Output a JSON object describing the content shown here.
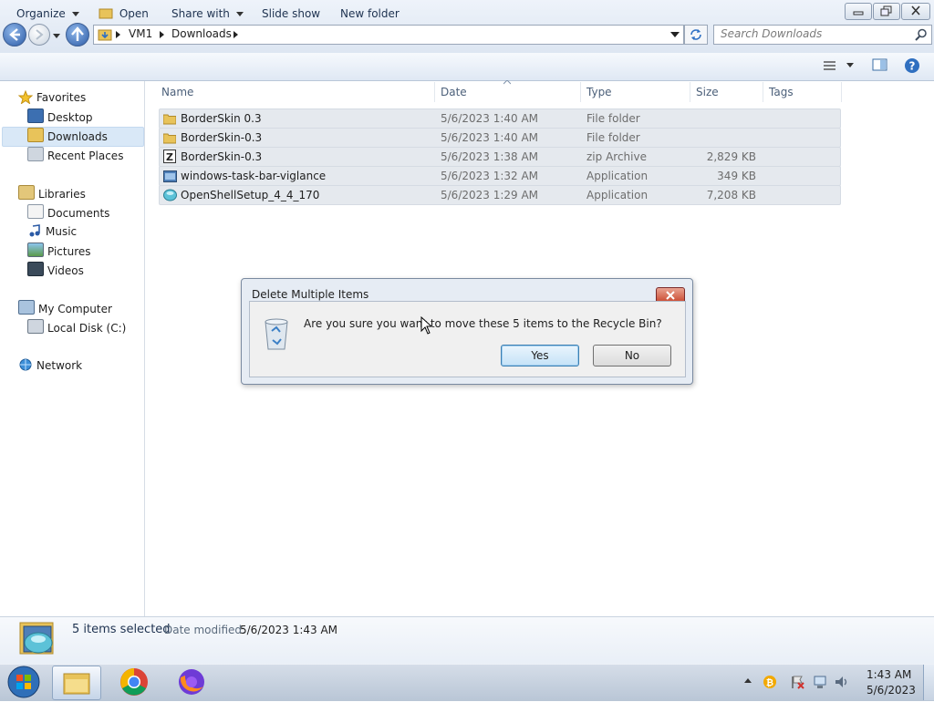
{
  "window": {
    "minimize_label": "▭",
    "restore_label": "❐",
    "close_label": "✕"
  },
  "address": {
    "segments": [
      "VM1",
      "Downloads"
    ],
    "search_placeholder": "Search Downloads"
  },
  "toolbar": {
    "organize": "Organize",
    "open": "Open",
    "share_with": "Share with",
    "slide_show": "Slide show",
    "new_folder": "New folder"
  },
  "nav": {
    "favorites": "Favorites",
    "desktop": "Desktop",
    "downloads": "Downloads",
    "recent_places": "Recent Places",
    "libraries": "Libraries",
    "documents": "Documents",
    "music": "Music",
    "pictures": "Pictures",
    "videos": "Videos",
    "my_computer": "My Computer",
    "local_disk": "Local Disk (C:)",
    "network": "Network"
  },
  "columns": {
    "name": "Name",
    "date": "Date",
    "type": "Type",
    "size": "Size",
    "tags": "Tags"
  },
  "files": [
    {
      "name": "BorderSkin 0.3",
      "date": "5/6/2023 1:40 AM",
      "type": "File folder",
      "size": "",
      "icon": "folder-icon"
    },
    {
      "name": "BorderSkin-0.3",
      "date": "5/6/2023 1:40 AM",
      "type": "File folder",
      "size": "",
      "icon": "folder-icon"
    },
    {
      "name": "BorderSkin-0.3",
      "date": "5/6/2023 1:38 AM",
      "type": "zip Archive",
      "size": "2,829 KB",
      "icon": "zip-icon"
    },
    {
      "name": "windows-task-bar-viglance",
      "date": "5/6/2023 1:32 AM",
      "type": "Application",
      "size": "349 KB",
      "icon": "application-icon"
    },
    {
      "name": "OpenShellSetup_4_4_170",
      "date": "5/6/2023 1:29 AM",
      "type": "Application",
      "size": "7,208 KB",
      "icon": "setup-icon"
    }
  ],
  "details": {
    "selected": "5 items selected",
    "date_modified_label": "Date modified:",
    "date_modified_value": "5/6/2023 1:43 AM"
  },
  "dialog": {
    "title": "Delete Multiple Items",
    "message": "Are you sure you want to move these 5 items to the Recycle Bin?",
    "yes": "Yes",
    "no": "No"
  },
  "taskbar": {
    "time": "1:43 AM",
    "date": "5/6/2023"
  },
  "colors": {
    "accent": "#3a6ea5",
    "selection": "#cde4f7"
  }
}
